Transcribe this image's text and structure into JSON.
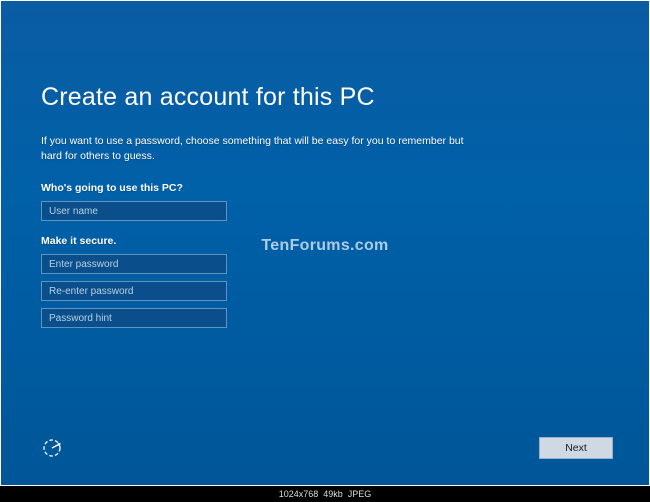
{
  "heading": "Create an account for this PC",
  "subtitle": "If you want to use a password, choose something that will be easy for you to remember but hard for others to guess.",
  "sections": {
    "user": {
      "label": "Who's going to use this PC?",
      "username_placeholder": "User name"
    },
    "secure": {
      "label": "Make it secure.",
      "password_placeholder": "Enter password",
      "reenter_placeholder": "Re-enter password",
      "hint_placeholder": "Password hint"
    }
  },
  "buttons": {
    "next": "Next"
  },
  "watermark": "TenForums.com",
  "imageinfo": {
    "dims": "1024x768",
    "size": "49kb",
    "format": "JPEG"
  }
}
